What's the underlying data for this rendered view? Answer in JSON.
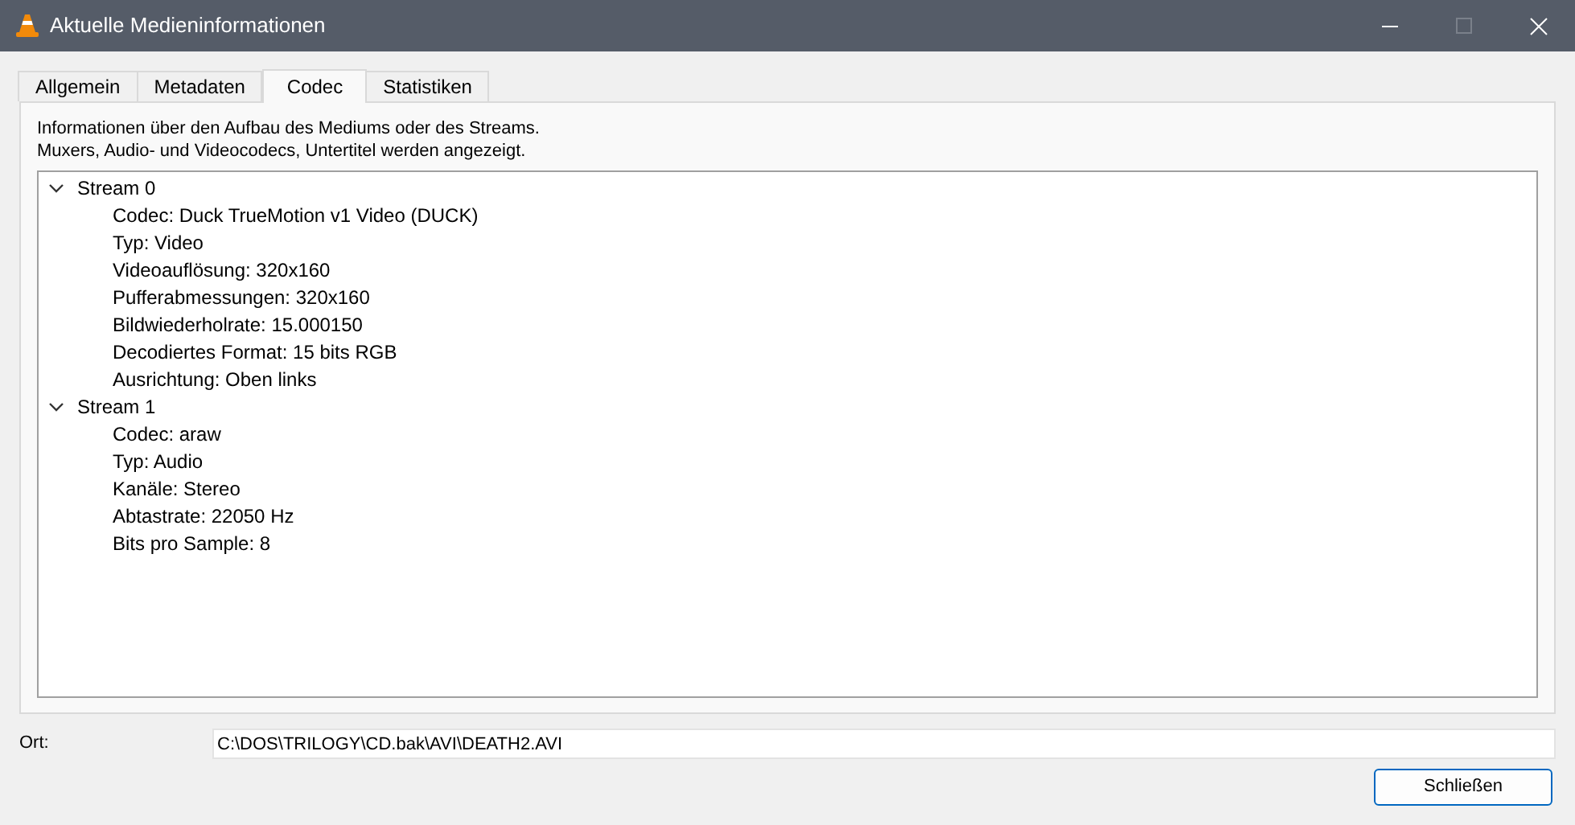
{
  "window": {
    "title": "Aktuelle Medieninformationen"
  },
  "tabs": [
    {
      "label": "Allgemein",
      "selected": false
    },
    {
      "label": "Metadaten",
      "selected": false
    },
    {
      "label": "Codec",
      "selected": true
    },
    {
      "label": "Statistiken",
      "selected": false
    }
  ],
  "description": [
    "Informationen über den Aufbau des Mediums oder des Streams.",
    "Muxers, Audio- und Videocodecs, Untertitel werden angezeigt."
  ],
  "tree": [
    {
      "label": "Stream 0",
      "expanded": true,
      "children": [
        {
          "label": "Codec: Duck TrueMotion v1 Video (DUCK)"
        },
        {
          "label": "Typ: Video"
        },
        {
          "label": "Videoauflösung: 320x160"
        },
        {
          "label": "Pufferabmessungen: 320x160"
        },
        {
          "label": "Bildwiederholrate: 15.000150"
        },
        {
          "label": "Decodiertes Format: 15 bits RGB"
        },
        {
          "label": "Ausrichtung: Oben links"
        }
      ]
    },
    {
      "label": "Stream 1",
      "expanded": true,
      "children": [
        {
          "label": "Codec: araw"
        },
        {
          "label": "Typ: Audio"
        },
        {
          "label": "Kanäle: Stereo"
        },
        {
          "label": "Abtastrate: 22050 Hz"
        },
        {
          "label": "Bits pro Sample: 8"
        }
      ]
    }
  ],
  "location": {
    "label": "Ort:",
    "value": "C:\\DOS\\TRILOGY\\CD.bak\\AVI\\DEATH2.AVI"
  },
  "buttons": [
    "Schließen"
  ]
}
